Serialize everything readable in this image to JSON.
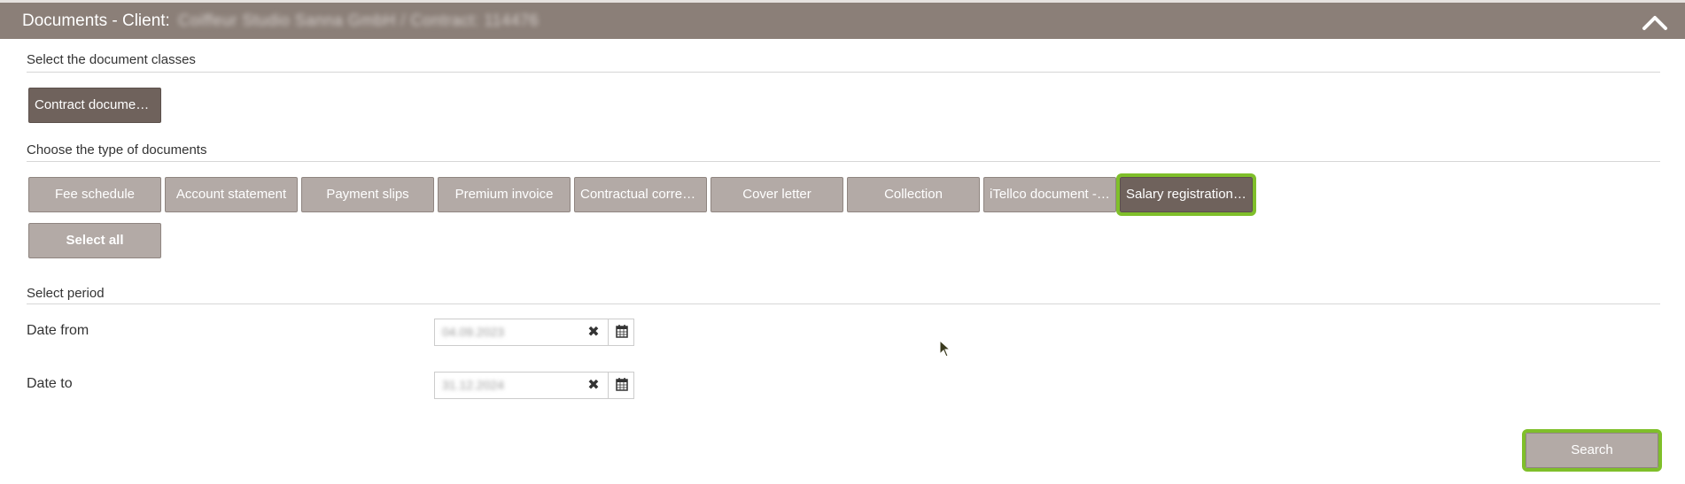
{
  "header": {
    "title": "Documents - Client:",
    "client_redacted": "Coiffeur Studio Sanna GmbH / Contract: 114476"
  },
  "classes_section": {
    "title": "Select the document classes",
    "buttons": [
      {
        "label": "Contract documen…",
        "selected": true
      }
    ]
  },
  "types_section": {
    "title": "Choose the type of documents",
    "buttons": [
      {
        "label": "Fee schedule"
      },
      {
        "label": "Account statement"
      },
      {
        "label": "Payment slips"
      },
      {
        "label": "Premium invoice"
      },
      {
        "label": "Contractual corres…"
      },
      {
        "label": "Cover letter"
      },
      {
        "label": "Collection"
      },
      {
        "label": "iTellco document - …"
      },
      {
        "label": "Salary registration …",
        "selected": true
      }
    ],
    "select_all_label": "Select all"
  },
  "period_section": {
    "title": "Select period",
    "date_from": {
      "label": "Date from",
      "value": "04.09.2023"
    },
    "date_to": {
      "label": "Date to",
      "value": "31.12.2024"
    }
  },
  "search_label": "Search",
  "colors": {
    "header_bg": "#8b7f78",
    "button_bg": "#b3aaa6",
    "button_selected_bg": "#6f625c",
    "highlight": "#7fbf2a"
  },
  "icons": [
    "chevron-up-icon",
    "clear-icon",
    "calendar-icon",
    "mouse-cursor-icon"
  ]
}
